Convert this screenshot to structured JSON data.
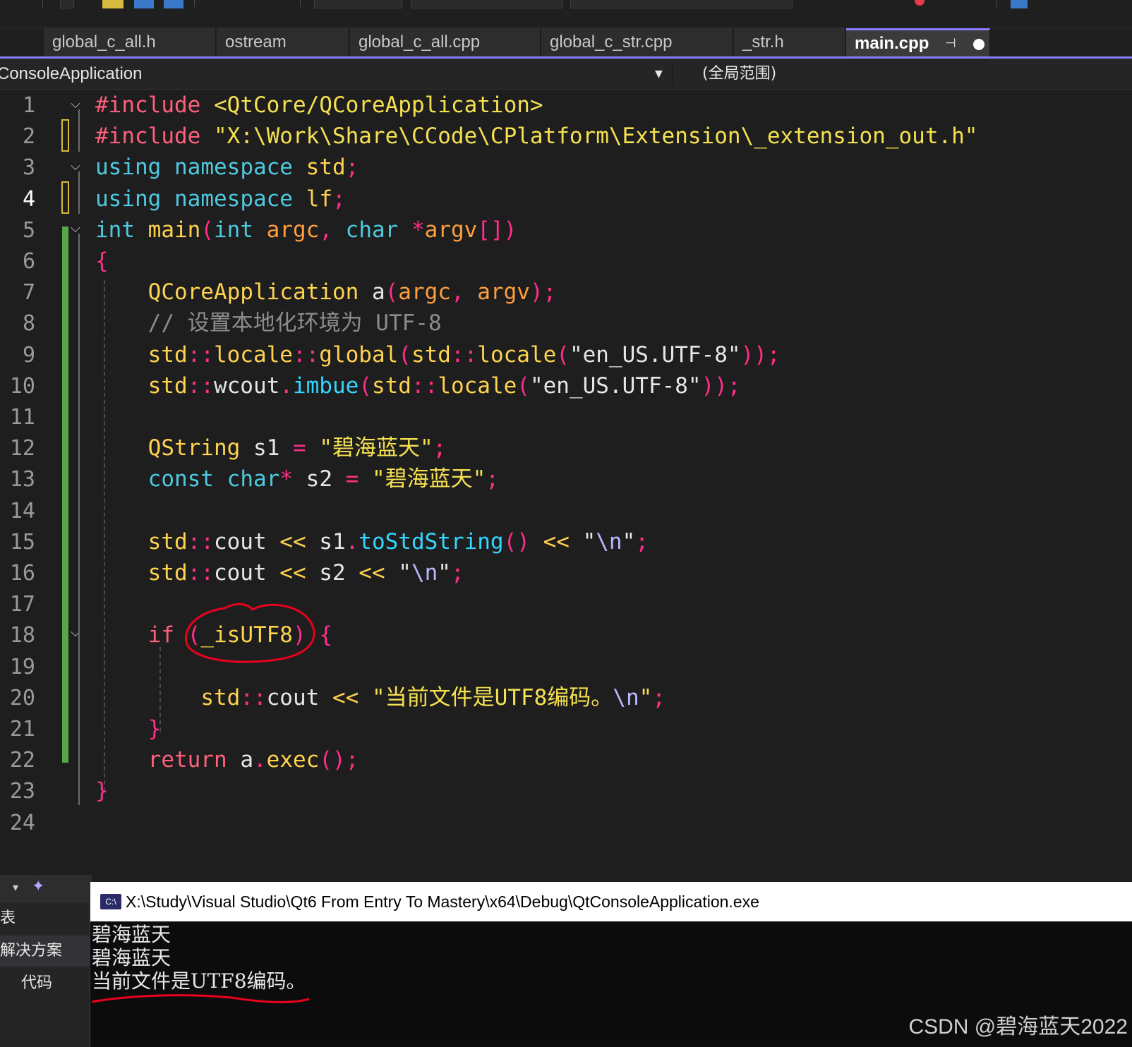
{
  "tabs": [
    {
      "label": "global_c_all.h"
    },
    {
      "label": "ostream"
    },
    {
      "label": "global_c_all.cpp"
    },
    {
      "label": "global_c_str.cpp"
    },
    {
      "label": "_str.h"
    },
    {
      "label": "main.cpp",
      "pin": "⊣",
      "active": true
    }
  ],
  "navbar": {
    "project": "ConsoleApplication",
    "scope": "(全局范围)"
  },
  "editor": {
    "current_line": 4,
    "line_numbers": [
      "1",
      "2",
      "3",
      "4",
      "5",
      "6",
      "7",
      "8",
      "9",
      "10",
      "11",
      "12",
      "13",
      "14",
      "15",
      "16",
      "17",
      "18",
      "19",
      "20",
      "21",
      "22",
      "23",
      "24"
    ],
    "lines": [
      [
        {
          "t": "#include",
          "c": "kw-pre"
        },
        {
          "t": " ",
          "c": "txt"
        },
        {
          "t": "<QtCore/QCoreApplication>",
          "c": "inc"
        }
      ],
      [
        {
          "t": "#include",
          "c": "kw-pre"
        },
        {
          "t": " ",
          "c": "txt"
        },
        {
          "t": "\"X:\\Work\\Share\\CCode\\CPlatform\\Extension\\_extension_out.h\"",
          "c": "str"
        }
      ],
      [
        {
          "t": "using",
          "c": "kw"
        },
        {
          "t": " ",
          "c": "txt"
        },
        {
          "t": "namespace",
          "c": "kw"
        },
        {
          "t": " ",
          "c": "txt"
        },
        {
          "t": "std",
          "c": "ns"
        },
        {
          "t": ";",
          "c": "punc"
        }
      ],
      [
        {
          "t": "using",
          "c": "kw"
        },
        {
          "t": " ",
          "c": "txt"
        },
        {
          "t": "namespace",
          "c": "kw"
        },
        {
          "t": " ",
          "c": "txt"
        },
        {
          "t": "lf",
          "c": "ns"
        },
        {
          "t": ";",
          "c": "punc"
        }
      ],
      [
        {
          "t": "int",
          "c": "kw"
        },
        {
          "t": " ",
          "c": "txt"
        },
        {
          "t": "main",
          "c": "type"
        },
        {
          "t": "(",
          "c": "punc"
        },
        {
          "t": "int",
          "c": "kw"
        },
        {
          "t": " ",
          "c": "txt"
        },
        {
          "t": "argc",
          "c": "var"
        },
        {
          "t": ", ",
          "c": "punc"
        },
        {
          "t": "char",
          "c": "kw"
        },
        {
          "t": " ",
          "c": "txt"
        },
        {
          "t": "*",
          "c": "punc"
        },
        {
          "t": "argv",
          "c": "var"
        },
        {
          "t": "[])",
          "c": "punc"
        }
      ],
      [
        {
          "t": "{",
          "c": "punc"
        }
      ],
      [
        {
          "t": "    ",
          "c": "txt"
        },
        {
          "t": "QCoreApplication",
          "c": "type"
        },
        {
          "t": " ",
          "c": "txt"
        },
        {
          "t": "a",
          "c": "txt"
        },
        {
          "t": "(",
          "c": "punc"
        },
        {
          "t": "argc",
          "c": "var"
        },
        {
          "t": ", ",
          "c": "punc"
        },
        {
          "t": "argv",
          "c": "var"
        },
        {
          "t": ");",
          "c": "punc"
        }
      ],
      [
        {
          "t": "    ",
          "c": "txt"
        },
        {
          "t": "// 设置本地化环境为 UTF-8",
          "c": "cmt"
        }
      ],
      [
        {
          "t": "    ",
          "c": "txt"
        },
        {
          "t": "std",
          "c": "ns"
        },
        {
          "t": "::",
          "c": "punc"
        },
        {
          "t": "locale",
          "c": "type"
        },
        {
          "t": "::",
          "c": "punc"
        },
        {
          "t": "global",
          "c": "type"
        },
        {
          "t": "(",
          "c": "punc"
        },
        {
          "t": "std",
          "c": "ns"
        },
        {
          "t": "::",
          "c": "punc"
        },
        {
          "t": "locale",
          "c": "type"
        },
        {
          "t": "(",
          "c": "punc"
        },
        {
          "t": "\"en_US.UTF-8\"",
          "c": "txt"
        },
        {
          "t": "));",
          "c": "punc"
        }
      ],
      [
        {
          "t": "    ",
          "c": "txt"
        },
        {
          "t": "std",
          "c": "ns"
        },
        {
          "t": "::",
          "c": "punc"
        },
        {
          "t": "wcout",
          "c": "txt"
        },
        {
          "t": ".",
          "c": "punc"
        },
        {
          "t": "imbue",
          "c": "fn"
        },
        {
          "t": "(",
          "c": "punc"
        },
        {
          "t": "std",
          "c": "ns"
        },
        {
          "t": "::",
          "c": "punc"
        },
        {
          "t": "locale",
          "c": "type"
        },
        {
          "t": "(",
          "c": "punc"
        },
        {
          "t": "\"en_US.UTF-8\"",
          "c": "txt"
        },
        {
          "t": "));",
          "c": "punc"
        }
      ],
      [],
      [
        {
          "t": "    ",
          "c": "txt"
        },
        {
          "t": "QString",
          "c": "type"
        },
        {
          "t": " ",
          "c": "txt"
        },
        {
          "t": "s1",
          "c": "txt"
        },
        {
          "t": " = ",
          "c": "punc"
        },
        {
          "t": "\"碧海蓝天\"",
          "c": "str"
        },
        {
          "t": ";",
          "c": "punc"
        }
      ],
      [
        {
          "t": "    ",
          "c": "txt"
        },
        {
          "t": "const",
          "c": "kw"
        },
        {
          "t": " ",
          "c": "txt"
        },
        {
          "t": "char",
          "c": "kw"
        },
        {
          "t": "*",
          "c": "punc"
        },
        {
          "t": " ",
          "c": "txt"
        },
        {
          "t": "s2",
          "c": "txt"
        },
        {
          "t": " = ",
          "c": "punc"
        },
        {
          "t": "\"碧海蓝天\"",
          "c": "str"
        },
        {
          "t": ";",
          "c": "punc"
        }
      ],
      [],
      [
        {
          "t": "    ",
          "c": "txt"
        },
        {
          "t": "std",
          "c": "ns"
        },
        {
          "t": "::",
          "c": "punc"
        },
        {
          "t": "cout",
          "c": "txt"
        },
        {
          "t": " << ",
          "c": "type"
        },
        {
          "t": "s1",
          "c": "txt"
        },
        {
          "t": ".",
          "c": "punc"
        },
        {
          "t": "toStdString",
          "c": "fn"
        },
        {
          "t": "()",
          "c": "punc"
        },
        {
          "t": " << ",
          "c": "type"
        },
        {
          "t": "\"",
          "c": "txt"
        },
        {
          "t": "\\n",
          "c": "esc"
        },
        {
          "t": "\"",
          "c": "txt"
        },
        {
          "t": ";",
          "c": "punc"
        }
      ],
      [
        {
          "t": "    ",
          "c": "txt"
        },
        {
          "t": "std",
          "c": "ns"
        },
        {
          "t": "::",
          "c": "punc"
        },
        {
          "t": "cout",
          "c": "txt"
        },
        {
          "t": " << ",
          "c": "type"
        },
        {
          "t": "s2",
          "c": "txt"
        },
        {
          "t": " << ",
          "c": "type"
        },
        {
          "t": "\"",
          "c": "txt"
        },
        {
          "t": "\\n",
          "c": "esc"
        },
        {
          "t": "\"",
          "c": "txt"
        },
        {
          "t": ";",
          "c": "punc"
        }
      ],
      [],
      [
        {
          "t": "    ",
          "c": "txt"
        },
        {
          "t": "if",
          "c": "ret"
        },
        {
          "t": " ",
          "c": "txt"
        },
        {
          "t": "(",
          "c": "punc"
        },
        {
          "t": "_isUTF8",
          "c": "type"
        },
        {
          "t": ")",
          "c": "punc"
        },
        {
          "t": " ",
          "c": "txt"
        },
        {
          "t": "{",
          "c": "punc"
        }
      ],
      [],
      [
        {
          "t": "        ",
          "c": "txt"
        },
        {
          "t": "std",
          "c": "ns"
        },
        {
          "t": "::",
          "c": "punc"
        },
        {
          "t": "cout",
          "c": "txt"
        },
        {
          "t": " << ",
          "c": "type"
        },
        {
          "t": "\"当前文件是UTF8编码。",
          "c": "str"
        },
        {
          "t": "\\n",
          "c": "esc"
        },
        {
          "t": "\"",
          "c": "str"
        },
        {
          "t": ";",
          "c": "punc"
        }
      ],
      [
        {
          "t": "    ",
          "c": "txt"
        },
        {
          "t": "}",
          "c": "punc"
        }
      ],
      [
        {
          "t": "    ",
          "c": "txt"
        },
        {
          "t": "return",
          "c": "ret"
        },
        {
          "t": " ",
          "c": "txt"
        },
        {
          "t": "a",
          "c": "txt"
        },
        {
          "t": ".",
          "c": "punc"
        },
        {
          "t": "exec",
          "c": "type"
        },
        {
          "t": "();",
          "c": "punc"
        }
      ],
      [
        {
          "t": "}",
          "c": "punc"
        }
      ],
      []
    ]
  },
  "panel": {
    "items": [
      "表",
      "解决方案",
      "代码"
    ]
  },
  "console": {
    "icon_label": "C:\\",
    "title": "X:\\Study\\Visual Studio\\Qt6 From Entry To Mastery\\x64\\Debug\\QtConsoleApplication.exe",
    "output": [
      "碧海蓝天",
      "碧海蓝天",
      "当前文件是UTF8编码。"
    ]
  },
  "watermark": "CSDN @碧海蓝天2022",
  "colors": {
    "accent": "#8a7cff",
    "annotation_red": "#e8001c",
    "changed_bar": "#57a64a"
  }
}
